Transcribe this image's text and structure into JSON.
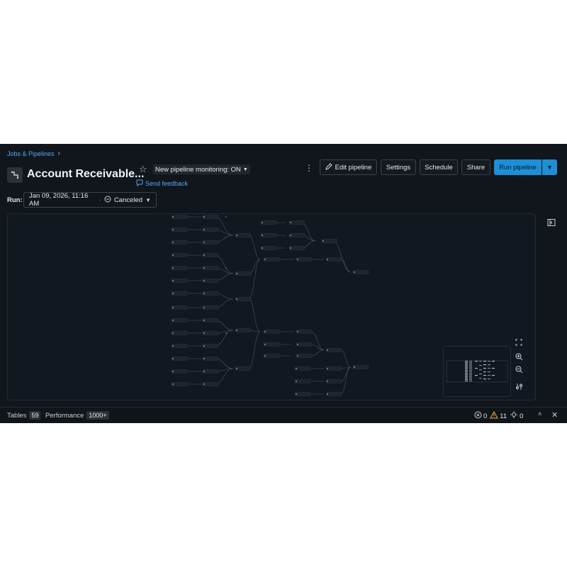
{
  "breadcrumb": {
    "root": "Jobs & Pipelines",
    "separator": "›"
  },
  "header": {
    "title": "Account Receivable...",
    "monitoring_label": "New pipeline monitoring: ON",
    "feedback_label": "Send feedback",
    "buttons": {
      "edit": "Edit pipeline",
      "settings": "Settings",
      "schedule": "Schedule",
      "share": "Share",
      "run": "Run pipeline"
    }
  },
  "run": {
    "label": "Run:",
    "date": "Jan 09, 2026, 11:16 AM",
    "separator": "·",
    "status": "Canceled"
  },
  "bottom": {
    "tables_label": "Tables",
    "tables_count": "59",
    "performance_label": "Performance",
    "performance_count": "1000+",
    "errors": "0",
    "warnings": "11",
    "suggestions": "0"
  },
  "colors": {
    "background": "#10161c",
    "accent": "#1d8fd6",
    "link": "#59a6ee",
    "warning": "#e8a33d",
    "graph_node": "#1c242c",
    "graph_edge": "#4a5561"
  },
  "icons": {
    "pipeline": "pipeline-icon",
    "star": "star-icon",
    "feedback": "chat-bubble-icon",
    "kebab": "kebab-menu-icon",
    "edit": "pencil-icon",
    "caret": "chevron-down-icon",
    "canceled": "canceled-icon",
    "side_panel": "side-panel-icon",
    "fit": "fit-view-icon",
    "zoom_in": "zoom-in-icon",
    "zoom_out": "zoom-out-icon",
    "layout": "layout-settings-icon",
    "error": "error-icon",
    "warning": "warning-icon",
    "suggestion": "lightbulb-icon",
    "expand": "chevron-up-icon",
    "close": "close-icon"
  }
}
